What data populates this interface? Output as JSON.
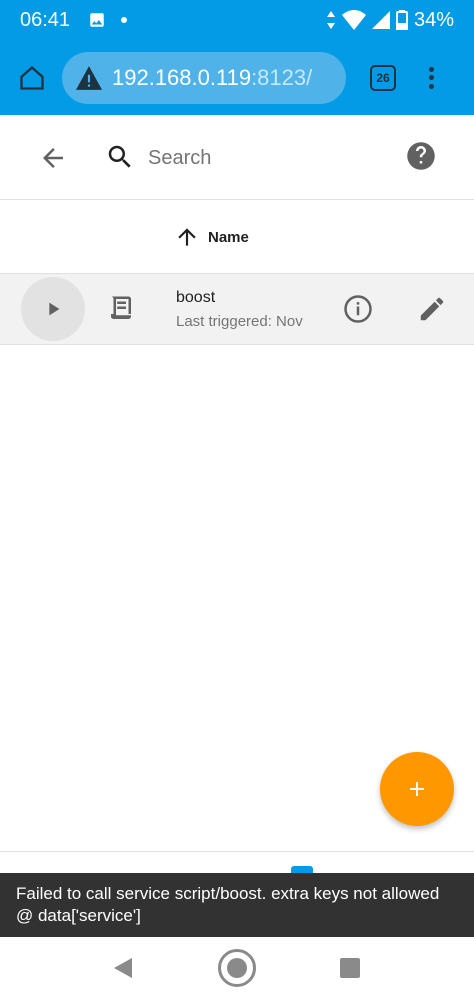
{
  "status_bar": {
    "time": "06:41",
    "battery_percent": "34%",
    "icons": [
      "image-icon",
      "dot-icon",
      "data-arrows-icon",
      "wifi-icon",
      "signal-icon",
      "battery-icon"
    ]
  },
  "browser": {
    "url_host": "192.168.0.119",
    "url_port": ":8123/",
    "tab_count": "26",
    "colors": {
      "toolbar": "#039be5"
    }
  },
  "search": {
    "placeholder": "Search"
  },
  "table": {
    "sort_column": "Name",
    "rows": [
      {
        "name": "boost",
        "subtitle": "Last triggered: Nov"
      }
    ]
  },
  "fab": {
    "icon": "plus-icon",
    "color": "#ff9800"
  },
  "snackbar": {
    "message": "Failed to call service script/boost. extra keys not allowed @ data['service']"
  }
}
